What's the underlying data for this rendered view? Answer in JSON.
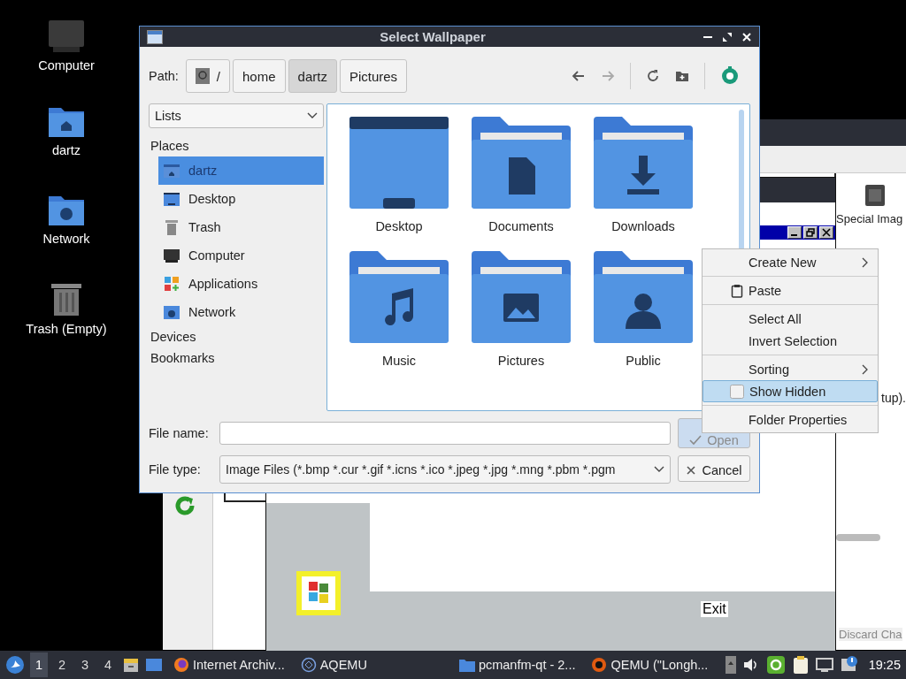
{
  "desktop_icons": [
    {
      "label": "Computer",
      "kind": "computer"
    },
    {
      "label": "dartz",
      "kind": "home"
    },
    {
      "label": "Network",
      "kind": "network"
    },
    {
      "label": "Trash (Empty)",
      "kind": "trash"
    }
  ],
  "background_window": {
    "item_label": "Special Imag",
    "text_fragment": "tup).",
    "button": "Discard Cha"
  },
  "emulator": {
    "exit_label": "Exit"
  },
  "dialog": {
    "title": "Select Wallpaper",
    "path_label": "Path:",
    "path": [
      {
        "label": "/",
        "kind": "root",
        "selected": false
      },
      {
        "label": "home",
        "kind": "dir",
        "selected": false
      },
      {
        "label": "dartz",
        "kind": "dir",
        "selected": true
      },
      {
        "label": "Pictures",
        "kind": "dir",
        "selected": false
      }
    ],
    "view_mode": "Lists",
    "sidebar": [
      {
        "title": "Places",
        "items": [
          {
            "label": "dartz",
            "kind": "home",
            "selected": true
          },
          {
            "label": "Desktop",
            "kind": "desktop",
            "selected": false
          },
          {
            "label": "Trash",
            "kind": "trash",
            "selected": false
          },
          {
            "label": "Computer",
            "kind": "computer",
            "selected": false
          },
          {
            "label": "Applications",
            "kind": "apps",
            "selected": false
          },
          {
            "label": "Network",
            "kind": "network",
            "selected": false
          }
        ]
      },
      {
        "title": "Devices"
      },
      {
        "title": "Bookmarks"
      }
    ],
    "files": [
      {
        "name": "Desktop",
        "kind": "desktop"
      },
      {
        "name": "Documents",
        "kind": "documents"
      },
      {
        "name": "Downloads",
        "kind": "downloads"
      },
      {
        "name": "Music",
        "kind": "music"
      },
      {
        "name": "Pictures",
        "kind": "pictures"
      },
      {
        "name": "Public",
        "kind": "public"
      }
    ],
    "file_name_label": "File name:",
    "file_type": {
      "label": "File type:",
      "value": "Image Files (*.bmp *.cur *.gif *.icns *.ico *.jpeg *.jpg *.mng *.pbm *.pgm"
    },
    "open_button": {
      "label": "Open",
      "disabled": true
    },
    "cancel_button": {
      "label": "Cancel"
    }
  },
  "context_menu": [
    [
      {
        "label": "Create New",
        "submenu": true,
        "kind": "plain",
        "highlighted": false
      }
    ],
    [
      {
        "label": "Paste",
        "submenu": false,
        "kind": "paste",
        "highlighted": false
      }
    ],
    [
      {
        "label": "Select All",
        "submenu": false,
        "kind": "plain",
        "highlighted": false
      },
      {
        "label": "Invert Selection",
        "submenu": false,
        "kind": "plain",
        "highlighted": false
      }
    ],
    [
      {
        "label": "Sorting",
        "submenu": true,
        "kind": "plain",
        "highlighted": false
      },
      {
        "label": "Show Hidden",
        "submenu": false,
        "kind": "toggle",
        "checked": false,
        "highlighted": true
      }
    ],
    [
      {
        "label": "Folder Properties",
        "submenu": false,
        "kind": "plain",
        "highlighted": false
      }
    ]
  ],
  "taskbar": {
    "workspaces": [
      {
        "label": "1",
        "selected": true
      },
      {
        "label": "2",
        "selected": false
      },
      {
        "label": "3",
        "selected": false
      },
      {
        "label": "4",
        "selected": false
      }
    ],
    "tasks": [
      {
        "label": "Internet Archiv...",
        "kind": "browser"
      },
      {
        "label": "AQEMU",
        "kind": "emulator"
      },
      {
        "label": "pcmanfm-qt - 2...",
        "kind": "folder"
      },
      {
        "label": "QEMU (\"Longh...",
        "kind": "qemu"
      }
    ],
    "clock": "19:25"
  }
}
